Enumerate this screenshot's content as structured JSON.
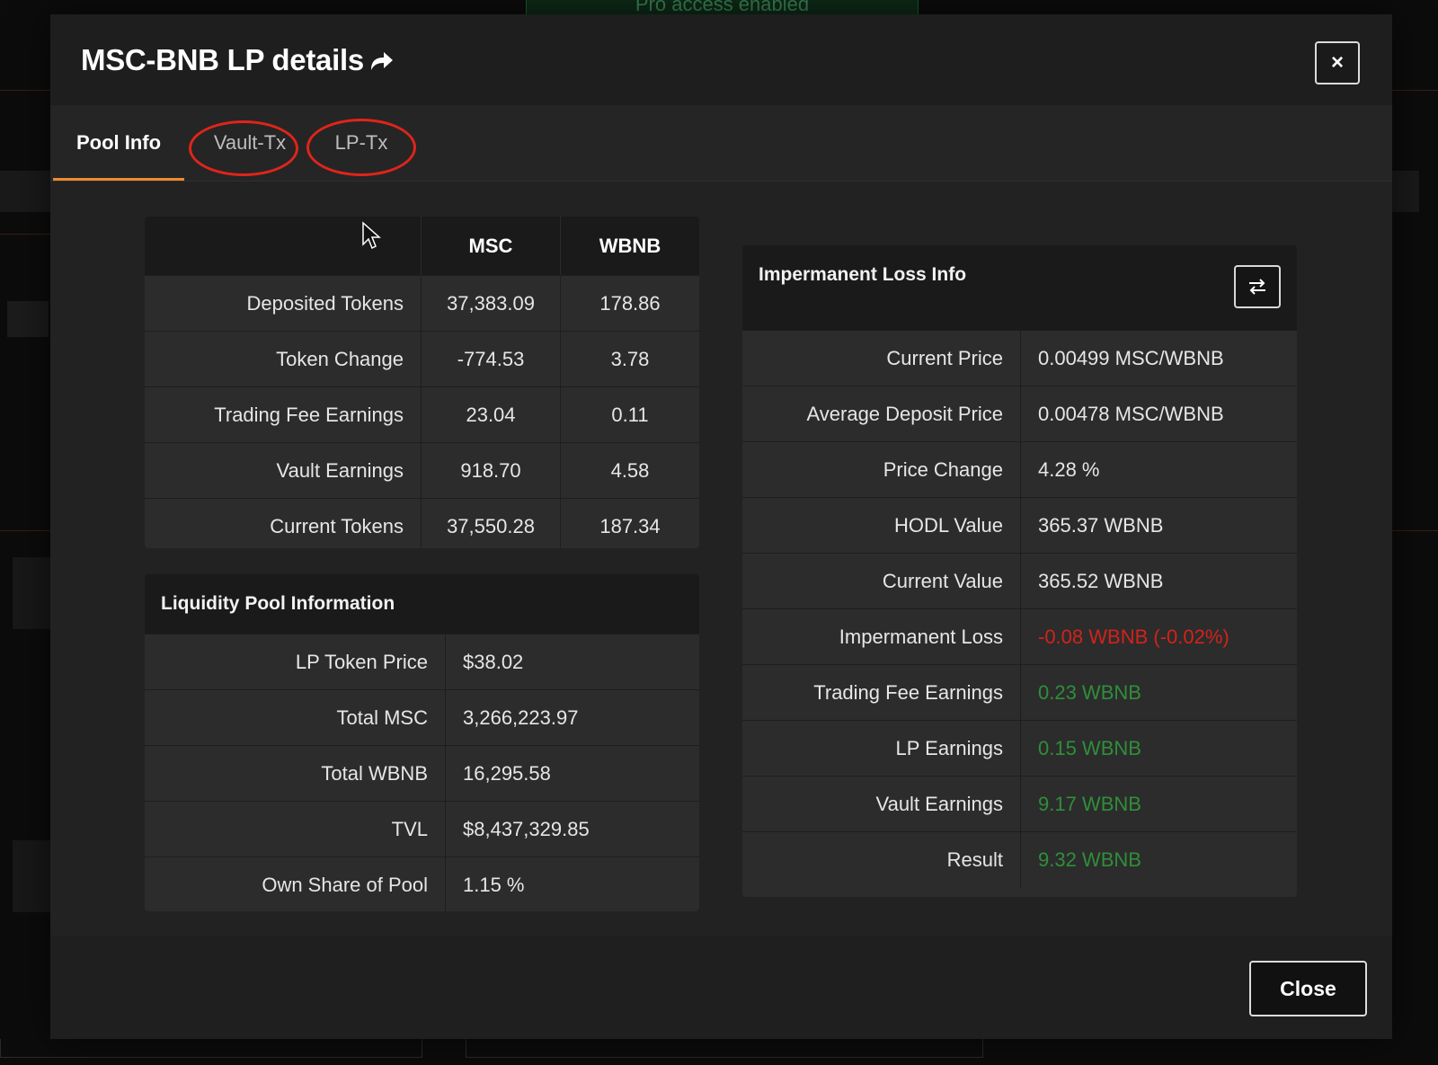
{
  "background": {
    "toast_text": "Pro access enabled"
  },
  "modal": {
    "title": "MSC-BNB LP details",
    "close_x": "×",
    "tabs": [
      {
        "label": "Pool Info"
      },
      {
        "label": "Vault-Tx"
      },
      {
        "label": "LP-Tx"
      }
    ],
    "token_table": {
      "columns": [
        "MSC",
        "WBNB"
      ],
      "rows": [
        {
          "label": "Deposited Tokens",
          "msc": "37,383.09",
          "wbnb": "178.86"
        },
        {
          "label": "Token Change",
          "msc": "-774.53",
          "wbnb": "3.78"
        },
        {
          "label": "Trading Fee Earnings",
          "msc": "23.04",
          "wbnb": "0.11"
        },
        {
          "label": "Vault Earnings",
          "msc": "918.70",
          "wbnb": "4.58"
        },
        {
          "label": "Current Tokens",
          "msc": "37,550.28",
          "wbnb": "187.34"
        }
      ]
    },
    "pool_table": {
      "title": "Liquidity Pool Information",
      "rows": [
        {
          "label": "LP Token Price",
          "value": "$38.02"
        },
        {
          "label": "Total MSC",
          "value": "3,266,223.97"
        },
        {
          "label": "Total WBNB",
          "value": "16,295.58"
        },
        {
          "label": "TVL",
          "value": "$8,437,329.85"
        },
        {
          "label": "Own Share of Pool",
          "value": "1.15 %"
        }
      ]
    },
    "il_table": {
      "title": "Impermanent Loss Info",
      "swap_icon": "swap-arrows-icon",
      "rows": [
        {
          "label": "Current Price",
          "value": "0.00499 MSC/WBNB",
          "tone": "normal"
        },
        {
          "label": "Average Deposit Price",
          "value": "0.00478 MSC/WBNB",
          "tone": "normal"
        },
        {
          "label": "Price Change",
          "value": "4.28 %",
          "tone": "normal"
        },
        {
          "label": "HODL Value",
          "value": "365.37 WBNB",
          "tone": "normal"
        },
        {
          "label": "Current Value",
          "value": "365.52 WBNB",
          "tone": "normal"
        },
        {
          "label": "Impermanent Loss",
          "value": "-0.08 WBNB (-0.02%)",
          "tone": "red"
        },
        {
          "label": "Trading Fee Earnings",
          "value": "0.23 WBNB",
          "tone": "green"
        },
        {
          "label": "LP Earnings",
          "value": "0.15 WBNB",
          "tone": "green"
        },
        {
          "label": "Vault Earnings",
          "value": "9.17 WBNB",
          "tone": "green"
        },
        {
          "label": "Result",
          "value": "9.32 WBNB",
          "tone": "green"
        }
      ]
    },
    "footer": {
      "close_label": "Close"
    }
  },
  "colors": {
    "accent": "#f08a2c",
    "positive": "#2f8f3a",
    "negative": "#d3221b",
    "annotation_ring": "#e0241b"
  }
}
